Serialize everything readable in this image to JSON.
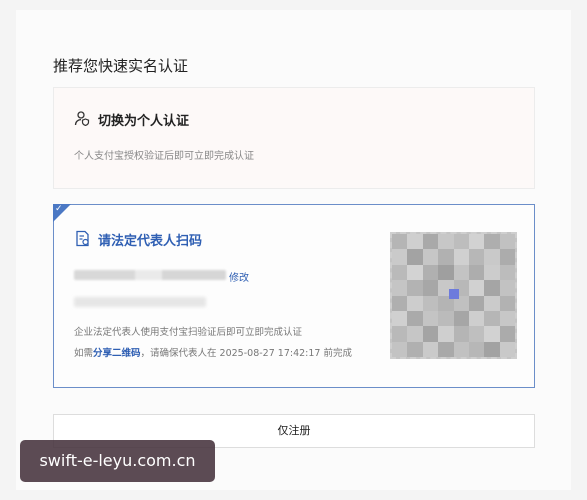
{
  "heading": "推荐您快速实名认证",
  "person_card": {
    "title": "切换为个人认证",
    "description": "个人支付宝授权验证后即可立即完成认证",
    "icon": "user-shield-icon"
  },
  "legal_card": {
    "title": "请法定代表人扫码",
    "icon": "document-scan-icon",
    "modify_label": "修改",
    "description_1": "企业法定代表人使用支付宝扫验证后即可立即完成认证",
    "description_2_prefix": "如需",
    "share_qr_label": "分享二维码",
    "description_2_suffix": "，请确保代表人在 2025-08-27 17:42:17 前完成",
    "selected": true,
    "accent_color": "#2f5fb3"
  },
  "register_only_label": "仅注册",
  "watermark": "swift-e-leyu.com.cn"
}
